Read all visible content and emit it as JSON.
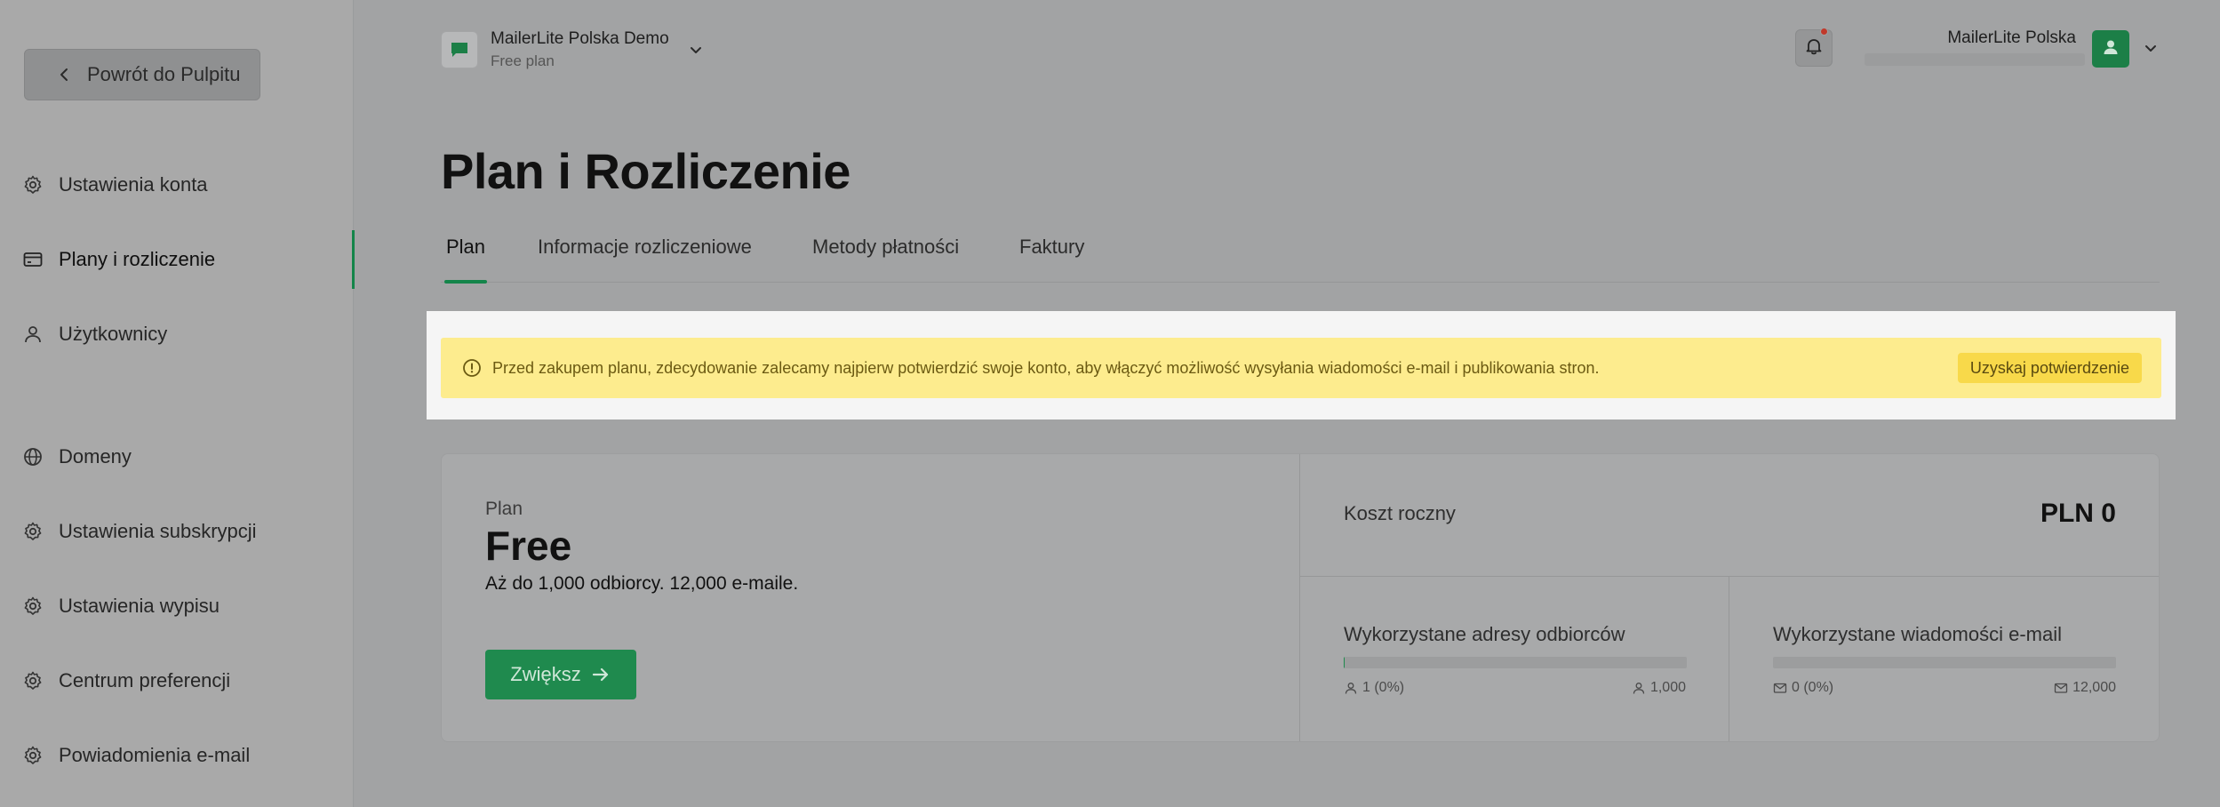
{
  "sidebar": {
    "back_label": "Powrót do Pulpitu",
    "items": [
      {
        "label": "Ustawienia konta",
        "icon": "gear-icon"
      },
      {
        "label": "Plany i rozliczenie",
        "icon": "credit-card-icon"
      },
      {
        "label": "Użytkownicy",
        "icon": "user-icon"
      },
      {
        "label": "Domeny",
        "icon": "globe-icon"
      },
      {
        "label": "Ustawienia subskrypcji",
        "icon": "gear-icon"
      },
      {
        "label": "Ustawienia wypisu",
        "icon": "gear-icon"
      },
      {
        "label": "Centrum preferencji",
        "icon": "gear-icon"
      },
      {
        "label": "Powiadomienia e-mail",
        "icon": "gear-icon"
      }
    ],
    "active_index": 1
  },
  "header": {
    "workspace_name": "MailerLite Polska Demo",
    "workspace_plan": "Free plan",
    "account_name": "MailerLite Polska"
  },
  "page": {
    "title": "Plan i Rozliczenie"
  },
  "tabs": [
    {
      "label": "Plan"
    },
    {
      "label": "Informacje rozliczeniowe"
    },
    {
      "label": "Metody płatności"
    },
    {
      "label": "Faktury"
    }
  ],
  "alert": {
    "text": "Przed zakupem planu, zdecydowanie zalecamy najpierw potwierdzić swoje konto, aby włączyć możliwość wysyłania wiadomości e-mail i publikowania stron.",
    "button_label": "Uzyskaj potwierdzenie"
  },
  "plan": {
    "label": "Plan",
    "name": "Free",
    "description": "Aż do 1,000 odbiorcy. 12,000 e-maile.",
    "upgrade_label": "Zwiększ",
    "annual_cost_label": "Koszt roczny",
    "annual_cost_value": "PLN 0"
  },
  "usage": {
    "subscribers": {
      "title": "Wykorzystane adresy odbiorców",
      "used": "1 (0%)",
      "limit": "1,000",
      "fraction": 0.001
    },
    "emails": {
      "title": "Wykorzystane wiadomości e-mail",
      "used": "0 (0%)",
      "limit": "12,000",
      "fraction": 0
    }
  },
  "colors": {
    "accent": "#14854a",
    "alert_bg": "#fdec8e",
    "alert_button": "#f8d94a",
    "notification_dot": "#c0392b"
  }
}
